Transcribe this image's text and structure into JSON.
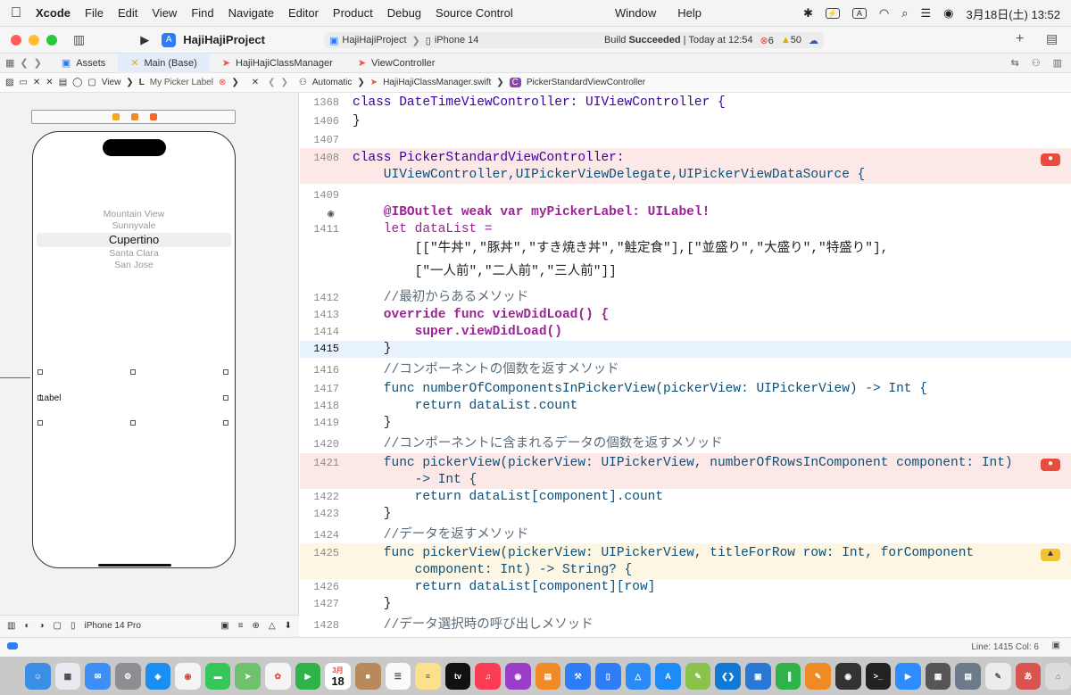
{
  "menubar": {
    "app": "Xcode",
    "items": [
      "File",
      "Edit",
      "View",
      "Find",
      "Navigate",
      "Editor",
      "Product",
      "Debug",
      "Source Control"
    ],
    "center_items": [
      "Window",
      "Help"
    ],
    "datetime": "3月18日(土) 13:52",
    "input_mode": "A"
  },
  "titlebar": {
    "project": "HajiHajiProject",
    "scheme_target": "HajiHajiProject",
    "device": "iPhone 14",
    "build_status": "Build",
    "build_result": "Succeeded",
    "build_time": "| Today at 12:54",
    "error_count": "6",
    "warning_count": "50"
  },
  "tabs": [
    "Assets",
    "Main (Base)",
    "HajiHajiClassManager",
    "ViewController"
  ],
  "ib_jumpbar": {
    "view_label": "View",
    "item_label": "My Picker Label"
  },
  "editor_jumpbar": {
    "mode": "Automatic",
    "file": "HajiHajiClassManager.swift",
    "symbol": "PickerStandardViewController"
  },
  "picker_rows": [
    "Mountain View",
    "Sunnyvale",
    "Cupertino",
    "Santa Clara",
    "San Jose"
  ],
  "ib": {
    "label_text": "Label",
    "device_footer": "iPhone 14 Pro"
  },
  "code": [
    {
      "n": "1368",
      "t": "class DateTimeViewController: UIViewController {"
    },
    {
      "n": "1406",
      "t": "}"
    },
    {
      "n": "1407",
      "t": ""
    },
    {
      "n": "1408",
      "t": "class PickerStandardViewController:"
    },
    {
      "n": "",
      "t": "    UIViewController,UIPickerViewDelegate,UIPickerViewDataSource {"
    },
    {
      "n": "1409",
      "t": ""
    },
    {
      "n": "",
      "t": "    @IBOutlet weak var myPickerLabel: UILabel!"
    },
    {
      "n": "1411",
      "t": "    let dataList ="
    },
    {
      "n": "",
      "t": "        [[\"牛丼\",\"豚丼\",\"すき焼き丼\",\"鮭定食\"],[\"並盛り\",\"大盛り\",\"特盛り\"],"
    },
    {
      "n": "",
      "t": "        [\"一人前\",\"二人前\",\"三人前\"]]"
    },
    {
      "n": "1412",
      "t": "    //最初からあるメソッド"
    },
    {
      "n": "1413",
      "t": "    override func viewDidLoad() {"
    },
    {
      "n": "1414",
      "t": "        super.viewDidLoad()"
    },
    {
      "n": "1415",
      "t": "    }"
    },
    {
      "n": "1416",
      "t": "    //コンポーネントの個数を返すメソッド"
    },
    {
      "n": "1417",
      "t": "    func numberOfComponentsInPickerView(pickerView: UIPickerView) -> Int {"
    },
    {
      "n": "1418",
      "t": "        return dataList.count"
    },
    {
      "n": "1419",
      "t": "    }"
    },
    {
      "n": "1420",
      "t": "    //コンポーネントに含まれるデータの個数を返すメソッド"
    },
    {
      "n": "1421",
      "t": "    func pickerView(pickerView: UIPickerView, numberOfRowsInComponent component: Int)"
    },
    {
      "n": "",
      "t": "        -> Int {"
    },
    {
      "n": "1422",
      "t": "        return dataList[component].count"
    },
    {
      "n": "1423",
      "t": "    }"
    },
    {
      "n": "1424",
      "t": "    //データを返すメソッド"
    },
    {
      "n": "1425",
      "t": "    func pickerView(pickerView: UIPickerView, titleForRow row: Int, forComponent"
    },
    {
      "n": "",
      "t": "        component: Int) -> String? {"
    },
    {
      "n": "1426",
      "t": "        return dataList[component][row]"
    },
    {
      "n": "1427",
      "t": "    }"
    },
    {
      "n": "1428",
      "t": "    //データ選択時の呼び出しメソッド"
    }
  ],
  "status": {
    "cursor": "Line: 1415  Col: 6"
  },
  "colors": {
    "error_line": "#fde8e8",
    "warning_line": "#fdf6e2",
    "current_line": "#e8f2fd",
    "accent": "#2f7df6"
  },
  "dock": {
    "calendar_month": "3月",
    "calendar_day": "18",
    "input_glyph": "あ"
  }
}
